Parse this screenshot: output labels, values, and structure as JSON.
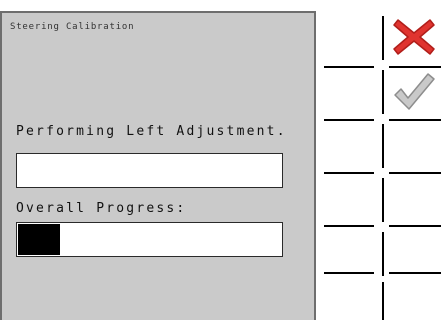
{
  "dialog": {
    "title": "Steering Calibration",
    "status_text": "Performing Left Adjustment.",
    "status_field_value": "",
    "progress_label": "Overall Progress:",
    "progress_fraction": 0.16
  },
  "side_buttons": [
    {
      "icon": "close-icon",
      "color": "#e0342f"
    },
    {
      "icon": "checkmark-icon",
      "color": "#a9a9a9"
    }
  ]
}
